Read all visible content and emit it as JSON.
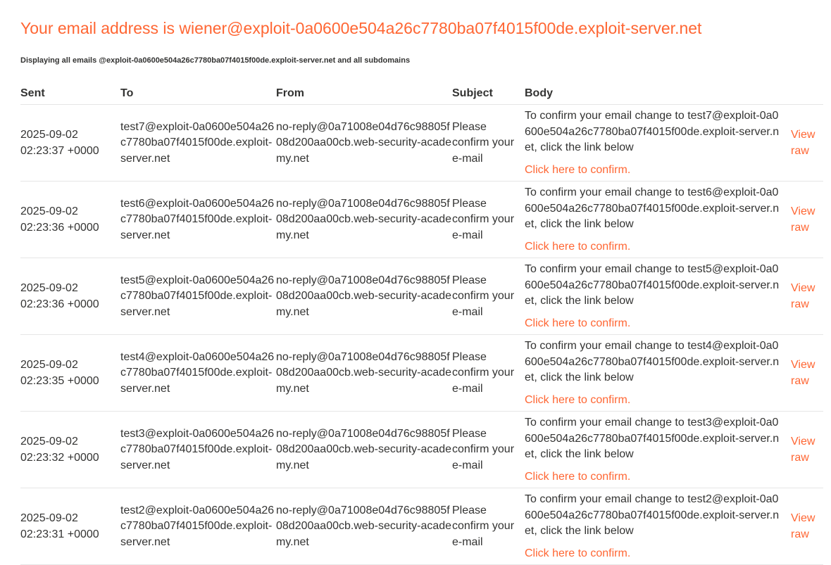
{
  "header": {
    "title": "Your email address is wiener@exploit-0a0600e504a26c7780ba07f4015f00de.exploit-server.net",
    "subtitle": "Displaying all emails @exploit-0a0600e504a26c7780ba07f4015f00de.exploit-server.net and all subdomains"
  },
  "table": {
    "columns": [
      "Sent",
      "To",
      "From",
      "Subject",
      "Body",
      ""
    ],
    "rows": [
      {
        "sent": "2025-09-02 02:23:37 +0000",
        "to": "test7@exploit-0a0600e504a26c7780ba07f4015f00de.exploit-server.net",
        "from": "no-reply@0a71008e04d76c98805f08d200aa00cb.web-security-academy.net",
        "subject": "Please confirm your e-mail",
        "body": "To confirm your email change to test7@exploit-0a0600e504a26c7780ba07f4015f00de.exploit-server.net, click the link below",
        "link": "Click here to confirm.",
        "raw": "View raw"
      },
      {
        "sent": "2025-09-02 02:23:36 +0000",
        "to": "test6@exploit-0a0600e504a26c7780ba07f4015f00de.exploit-server.net",
        "from": "no-reply@0a71008e04d76c98805f08d200aa00cb.web-security-academy.net",
        "subject": "Please confirm your e-mail",
        "body": "To confirm your email change to test6@exploit-0a0600e504a26c7780ba07f4015f00de.exploit-server.net, click the link below",
        "link": "Click here to confirm.",
        "raw": "View raw"
      },
      {
        "sent": "2025-09-02 02:23:36 +0000",
        "to": "test5@exploit-0a0600e504a26c7780ba07f4015f00de.exploit-server.net",
        "from": "no-reply@0a71008e04d76c98805f08d200aa00cb.web-security-academy.net",
        "subject": "Please confirm your e-mail",
        "body": "To confirm your email change to test5@exploit-0a0600e504a26c7780ba07f4015f00de.exploit-server.net, click the link below",
        "link": "Click here to confirm.",
        "raw": "View raw"
      },
      {
        "sent": "2025-09-02 02:23:35 +0000",
        "to": "test4@exploit-0a0600e504a26c7780ba07f4015f00de.exploit-server.net",
        "from": "no-reply@0a71008e04d76c98805f08d200aa00cb.web-security-academy.net",
        "subject": "Please confirm your e-mail",
        "body": "To confirm your email change to test4@exploit-0a0600e504a26c7780ba07f4015f00de.exploit-server.net, click the link below",
        "link": "Click here to confirm.",
        "raw": "View raw"
      },
      {
        "sent": "2025-09-02 02:23:32 +0000",
        "to": "test3@exploit-0a0600e504a26c7780ba07f4015f00de.exploit-server.net",
        "from": "no-reply@0a71008e04d76c98805f08d200aa00cb.web-security-academy.net",
        "subject": "Please confirm your e-mail",
        "body": "To confirm your email change to test3@exploit-0a0600e504a26c7780ba07f4015f00de.exploit-server.net, click the link below",
        "link": "Click here to confirm.",
        "raw": "View raw"
      },
      {
        "sent": "2025-09-02 02:23:31 +0000",
        "to": "test2@exploit-0a0600e504a26c7780ba07f4015f00de.exploit-server.net",
        "from": "no-reply@0a71008e04d76c98805f08d200aa00cb.web-security-academy.net",
        "subject": "Please confirm your e-mail",
        "body": "To confirm your email change to test2@exploit-0a0600e504a26c7780ba07f4015f00de.exploit-server.net, click the link below",
        "link": "Click here to confirm.",
        "raw": "View raw"
      }
    ]
  }
}
